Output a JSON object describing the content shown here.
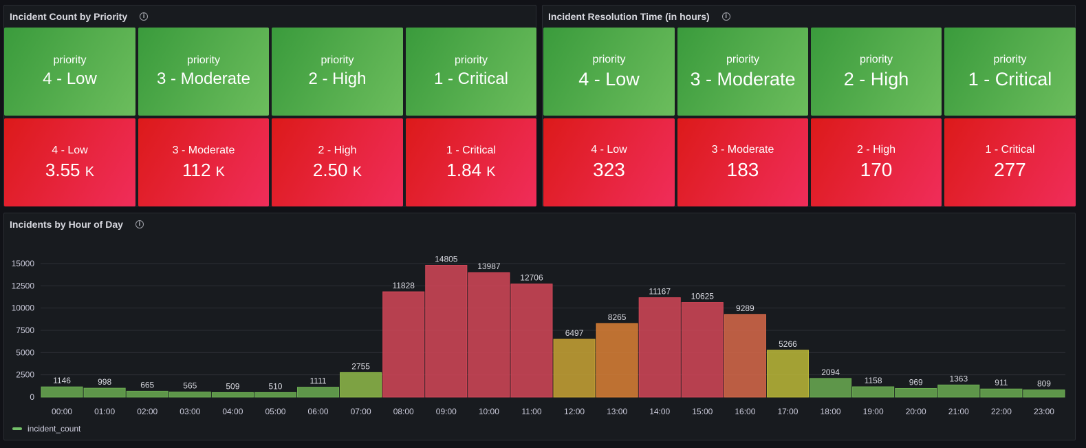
{
  "panels": {
    "count": {
      "title": "Incident Count by Priority",
      "header_label": "priority",
      "priorities": [
        "4 - Low",
        "3 - Moderate",
        "2 - High",
        "1 - Critical"
      ],
      "values": [
        {
          "label": "4 - Low",
          "num": "3.55",
          "unit": "K"
        },
        {
          "label": "3 - Moderate",
          "num": "112",
          "unit": "K"
        },
        {
          "label": "2 - High",
          "num": "2.50",
          "unit": "K"
        },
        {
          "label": "1 - Critical",
          "num": "1.84",
          "unit": "K"
        }
      ]
    },
    "resolution": {
      "title": "Incident Resolution Time (in hours)",
      "header_label": "priority",
      "priorities": [
        "4 - Low",
        "3 - Moderate",
        "2 - High",
        "1 - Critical"
      ],
      "values": [
        {
          "label": "4 - Low",
          "num": "323"
        },
        {
          "label": "3 - Moderate",
          "num": "183"
        },
        {
          "label": "2 - High",
          "num": "170"
        },
        {
          "label": "1 - Critical",
          "num": "277"
        }
      ]
    },
    "hourly": {
      "title": "Incidents by Hour of Day",
      "legend": "incident_count"
    }
  },
  "colors": {
    "low": "#73bf69",
    "mid": "#c8b33a",
    "orange": "#e28038",
    "high": "#d44a5a"
  },
  "chart_data": {
    "type": "bar",
    "categories": [
      "00:00",
      "01:00",
      "02:00",
      "03:00",
      "04:00",
      "05:00",
      "06:00",
      "07:00",
      "08:00",
      "09:00",
      "10:00",
      "11:00",
      "12:00",
      "13:00",
      "14:00",
      "15:00",
      "16:00",
      "17:00",
      "18:00",
      "19:00",
      "20:00",
      "21:00",
      "22:00",
      "23:00"
    ],
    "series": [
      {
        "name": "incident_count",
        "values": [
          1146,
          998,
          665,
          565,
          509,
          510,
          1111,
          2755,
          11828,
          14805,
          13987,
          12706,
          6497,
          8265,
          11167,
          10625,
          9289,
          5266,
          2094,
          1158,
          969,
          1363,
          911,
          809
        ]
      }
    ],
    "yticks": [
      0,
      2500,
      5000,
      7500,
      10000,
      12500,
      15000
    ],
    "ylim": [
      0,
      15500
    ],
    "grid": true,
    "legend_position": "bottom-left"
  }
}
